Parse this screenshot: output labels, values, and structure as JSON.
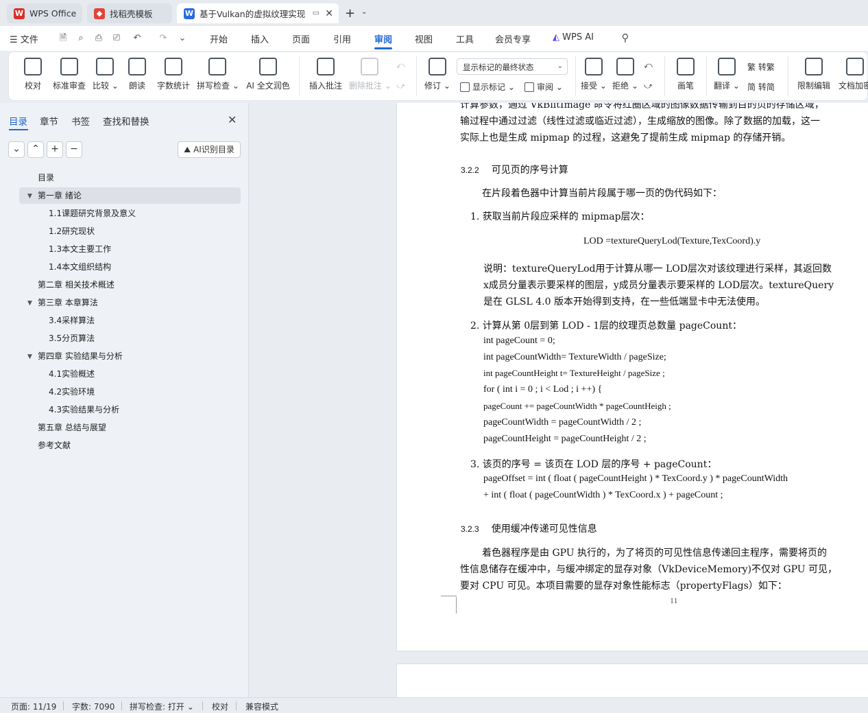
{
  "tabs": [
    {
      "label": "WPS Office",
      "icon": "wps-logo",
      "color": "#d9302a"
    },
    {
      "label": "找稻壳模板",
      "icon": "docer-logo",
      "color": "#e0453a"
    },
    {
      "label": "基于Vulkan的虚拟纹理实现",
      "icon": "writer-logo",
      "color": "#2b6ae0"
    }
  ],
  "menubar": {
    "file": "文件",
    "items": [
      "开始",
      "插入",
      "页面",
      "引用",
      "审阅",
      "视图",
      "工具",
      "会员专享"
    ],
    "active": "审阅",
    "wps_ai": "WPS AI"
  },
  "ribbon": {
    "proofread": "校对",
    "standard_review": "标准审查",
    "compare": "比较",
    "read_aloud": "朗读",
    "word_count": "字数统计",
    "spell_check": "拼写检查",
    "ai_polish": "AI 全文润色",
    "insert_comment": "插入批注",
    "delete_comment": "删除批注",
    "revise": "修订",
    "display_mode": "显示标记的最终状态",
    "show_markup": "显示标记",
    "review": "审阅",
    "accept": "接受",
    "reject": "拒绝",
    "pen": "画笔",
    "translate": "翻译",
    "to_traditional": "转繁",
    "to_simplified": "转简",
    "restrict_edit": "限制编辑",
    "doc_encrypt": "文档加密",
    "accent": "#1f66d6"
  },
  "nav": {
    "tabs": [
      "目录",
      "章节",
      "书签",
      "查找和替换"
    ],
    "active_tab": "目录",
    "ai_button": "AI识别目录",
    "toc": [
      {
        "label": "目录",
        "level": 0
      },
      {
        "label": "第一章  绪论",
        "level": 0,
        "expanded": true,
        "selected": true
      },
      {
        "label": "1.1课题研究背景及意义",
        "level": 1
      },
      {
        "label": "1.2研究现状",
        "level": 1
      },
      {
        "label": "1.3本文主要工作",
        "level": 1
      },
      {
        "label": "1.4本文组织结构",
        "level": 1
      },
      {
        "label": "第二章  相关技术概述",
        "level": 0
      },
      {
        "label": "第三章  本章算法",
        "level": 0,
        "expanded": true
      },
      {
        "label": "3.4采样算法",
        "level": 1
      },
      {
        "label": "3.5分页算法",
        "level": 1
      },
      {
        "label": "第四章  实验结果与分析",
        "level": 0,
        "expanded": true
      },
      {
        "label": "4.1实验概述",
        "level": 1
      },
      {
        "label": "4.2实验环境",
        "level": 1
      },
      {
        "label": "4.3实验结果与分析",
        "level": 1
      },
      {
        "label": "第五章  总结与展望",
        "level": 0
      },
      {
        "label": "参考文献",
        "level": 0
      }
    ]
  },
  "doc": {
    "p_top_1": "计算参数，通过  VkBlitImage 命令将红圈区域的图像数据传输到目的页的存储区域，",
    "p_top_2": "输过程中通过过滤（线性过滤或临近过滤），生成缩放的图像。除了数据的加载，这一",
    "p_top_3": "实际上也是生成 mipmap 的过程，这避免了提前生成 mipmap 的存储开销。",
    "h322_num": "3.2.2",
    "h322": "可见页的序号计算",
    "p_intro": "在片段着色器中计算当前片段属于哪一页的伪代码如下：",
    "s1": "1.  获取当前片段应采样的  mipmap层次：",
    "formula": "LOD =textureQueryLod(Texture,TexCoord).y",
    "note_1": "说明：textureQueryLod用于计算从哪一  LOD层次对该纹理进行采样，其返回数",
    "note_2": "x成员分量表示要采样的图层，y成员分量表示要采样的  LOD层次。textureQuery",
    "note_3": "是在  GLSL 4.0 版本开始得到支持，在一些低端显卡中无法使用。",
    "s2": "2.  计算从第  0层到第  LOD - 1层的纹理页总数量  pageCount：",
    "code_1": "int pageCount  = 0;",
    "code_2": "int pageCountWidth= TextureWidth / pageSize;",
    "code_3": "int pageCountHeight t= TextureHeight  /  pageSize ;",
    "code_4": "for ( int i = 0 ; i < Lod ; i ++) {",
    "code_5": "pageCount += pageCountWidth * pageCountHeigh ;",
    "code_6": "pageCountWidth  = pageCountWidth  /  2 ;",
    "code_7": "pageCountHeight = pageCountHeight / 2 ;",
    "s3": "3.  该页的序号  = 该页在  LOD 层的序号  + pageCount：",
    "code_8": "pageOffset = int ( float ( pageCountHeight ) * TexCoord.y ) * pageCountWidth",
    "code_9": "+ int ( float ( pageCountWidth ) * TexCoord.x ) + pageCount ;",
    "h323_num": "3.2.3",
    "h323": "使用缓冲传递可见性信息",
    "p_last_1": "着色器程序是由  GPU 执行的，为了将页的可见性信息传递回主程序，需要将页的",
    "p_last_2": "性信息储存在缓冲中，与缓冲绑定的显存对象（VkDeviceMemory)不仅对  GPU 可见，",
    "p_last_3": "要对 CPU 可见。本项目需要的显存对象性能标志（propertyFlags）如下：",
    "page_number": "11"
  },
  "status": {
    "page": "页面: 11/19",
    "words": "字数: 7090",
    "spell": "拼写检查: 打开",
    "proof": "校对",
    "compat": "兼容模式"
  }
}
